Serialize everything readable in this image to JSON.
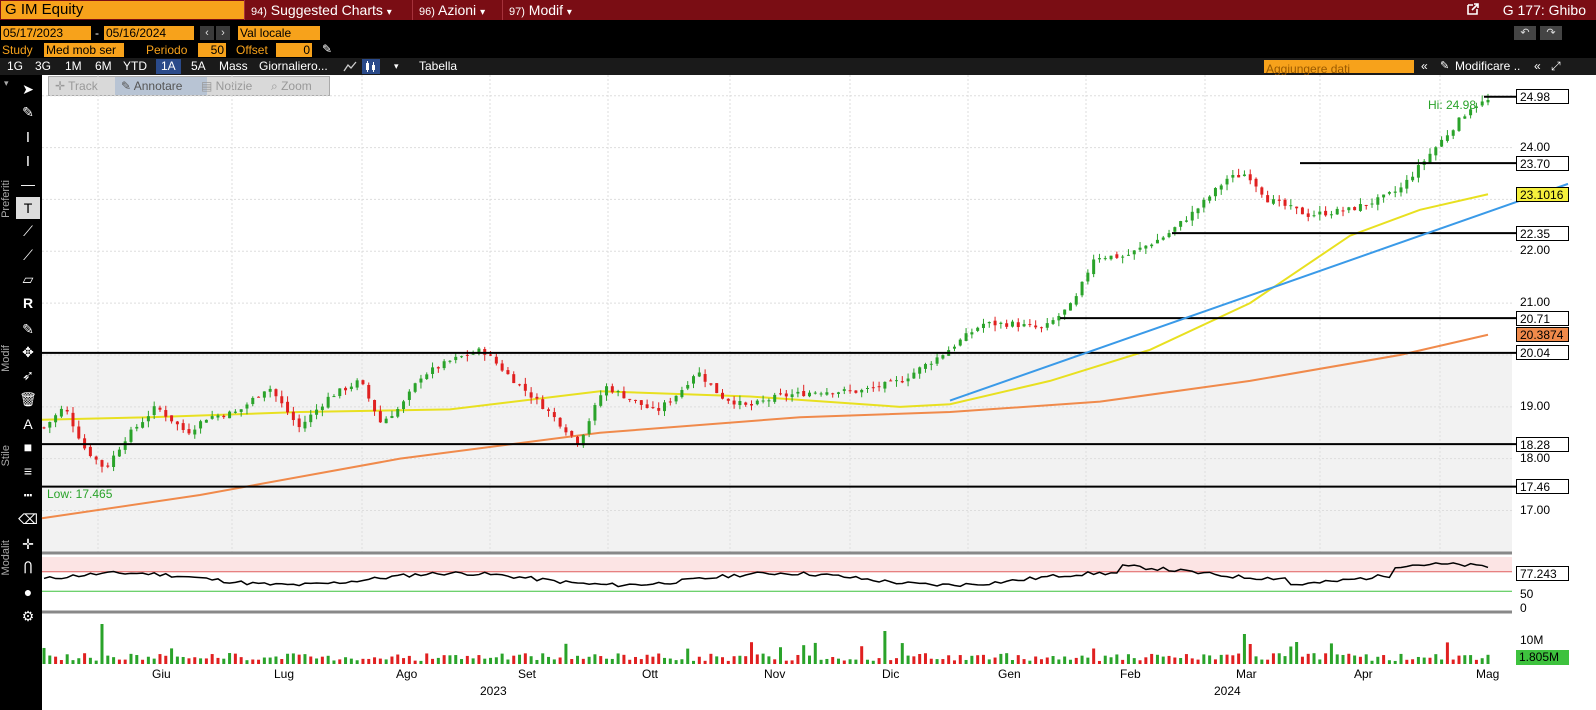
{
  "titlebar": {
    "ticker": "G IM Equity",
    "menus": [
      {
        "num": "94)",
        "label": "Suggested Charts",
        "arrow": "▾"
      },
      {
        "num": "96)",
        "label": "Azioni",
        "arrow": "▾"
      },
      {
        "num": "97)",
        "label": "Modif",
        "arrow": "▾"
      }
    ],
    "graph_title": "G 177: Ghibo"
  },
  "controls": {
    "date_from": "05/17/2023",
    "date_sep": "-",
    "date_to": "05/16/2024",
    "currency": "Val locale",
    "study_label": "Study",
    "study_value": "Med mob ser",
    "periodo_label": "Periodo",
    "periodo_value": "50",
    "offset_label": "Offset",
    "offset_value": "0"
  },
  "periods": [
    "1G",
    "3G",
    "1M",
    "6M",
    "YTD",
    "1A",
    "5A",
    "Mass",
    "Giornaliero..."
  ],
  "active_period": "1A",
  "table_label": "Tabella",
  "add_data_placeholder": "Aggiungere dati",
  "modify_label": "Modificare ..",
  "tool_tabs": [
    "Track",
    "Annotare",
    "Notizie",
    "Zoom"
  ],
  "left_labels": {
    "preferiti": "Preferiti",
    "modif": "Modif",
    "stile": "Stile",
    "modalita": "Modalit"
  },
  "chart_data": {
    "type": "candlestick",
    "y_ticks": [
      "24.00",
      "22.00",
      "21.00",
      "19.00",
      "18.00",
      "17.00"
    ],
    "y_tick_values": [
      24,
      22,
      21,
      19,
      18,
      17
    ],
    "ylim": [
      16.2,
      25.4
    ],
    "price_labels": [
      {
        "text": "24.98",
        "value": 24.98,
        "bg": "#ffffff"
      },
      {
        "text": "23.70",
        "value": 23.7,
        "bg": "#ffffff"
      },
      {
        "text": "23.1016",
        "value": 23.1016,
        "bg": "#f5f03c"
      },
      {
        "text": "22.35",
        "value": 22.35,
        "bg": "#ffffff"
      },
      {
        "text": "20.71",
        "value": 20.71,
        "bg": "#ffffff"
      },
      {
        "text": "20.3874",
        "value": 20.3874,
        "bg": "#f08a4b"
      },
      {
        "text": "20.04",
        "value": 20.04,
        "bg": "#ffffff"
      },
      {
        "text": "18.28",
        "value": 18.28,
        "bg": "#ffffff"
      },
      {
        "text": "17.46",
        "value": 17.46,
        "bg": "#ffffff"
      }
    ],
    "hi_label": "Hi: 24.98",
    "low_label": "Low: 17.465",
    "x_months": [
      "Giu",
      "Lug",
      "Ago",
      "Set",
      "Ott",
      "Nov",
      "Dic",
      "Gen",
      "Feb",
      "Mar",
      "Apr",
      "Mag"
    ],
    "years": [
      "2023",
      "2024"
    ],
    "rsi": {
      "value_label": "77.243",
      "ticks": [
        "50",
        "0"
      ]
    },
    "volume": {
      "ticks": [
        "10M"
      ],
      "value_label": "1.805M"
    },
    "colors": {
      "up": "#2aa32a",
      "down": "#e02020",
      "ma50": "#e8e020",
      "ma200": "#f08a4b",
      "trend": "#3a9ae8"
    }
  }
}
